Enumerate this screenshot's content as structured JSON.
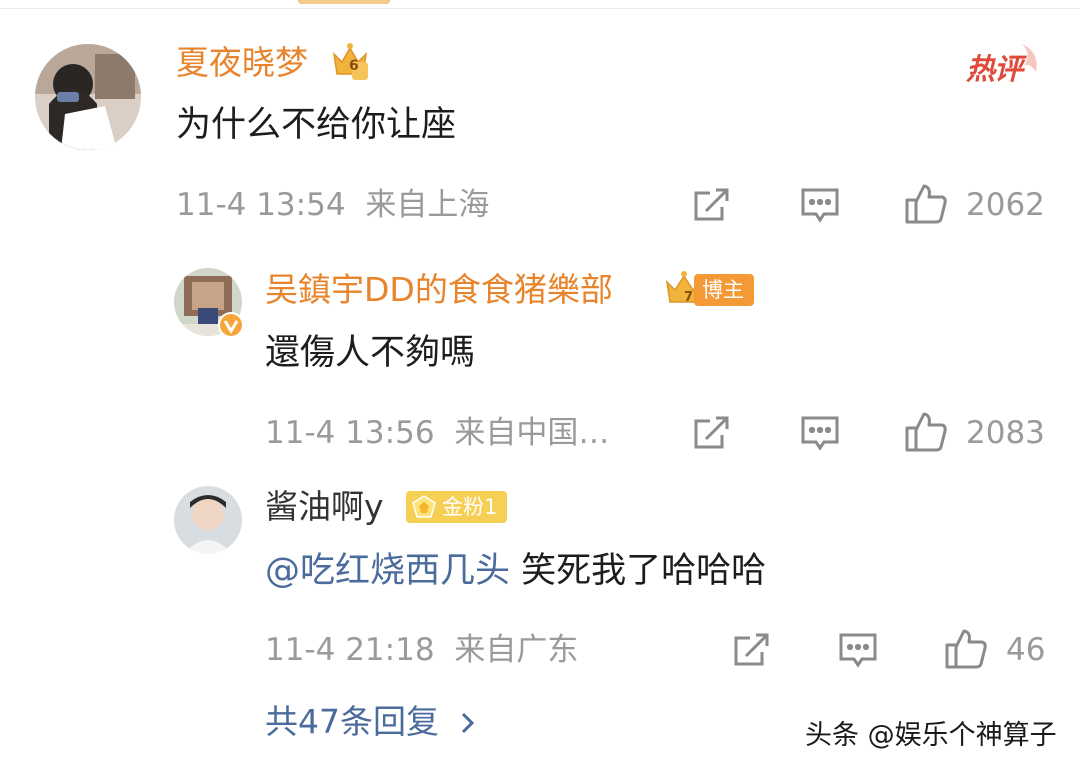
{
  "comment": {
    "user": "夏夜晓梦",
    "level_badge": "6",
    "hot_label": "热评",
    "text": "为什么不给你让座",
    "time": "11-4 13:54",
    "location": "来自上海",
    "likes": "2062"
  },
  "replies": [
    {
      "user": "吴鎮宇DD的食食猪樂部",
      "badge_label": "博主",
      "badge_number": "7",
      "text": "還傷人不夠嗎",
      "time": "11-4 13:56",
      "location": "来自中国…",
      "likes": "2083"
    },
    {
      "user": "酱油啊y",
      "badge_label": "金粉1",
      "mention": "@吃红烧西几头",
      "text": " 笑死我了哈哈哈",
      "time": "11-4 21:18",
      "location": "来自广东",
      "likes": "46"
    }
  ],
  "more_replies": "共47条回复",
  "watermark": "头条 @娱乐个神算子",
  "colors": {
    "username_orange": "#e8842c",
    "link_blue": "#4a6b9c",
    "meta_gray": "#9a9a9a",
    "hot_red": "#e04a3a",
    "gold_badge": "#f0b43c"
  },
  "icons": [
    "crown-badge-icon",
    "share-icon",
    "comment-icon",
    "like-icon",
    "chevron-right-icon",
    "verified-icon"
  ]
}
